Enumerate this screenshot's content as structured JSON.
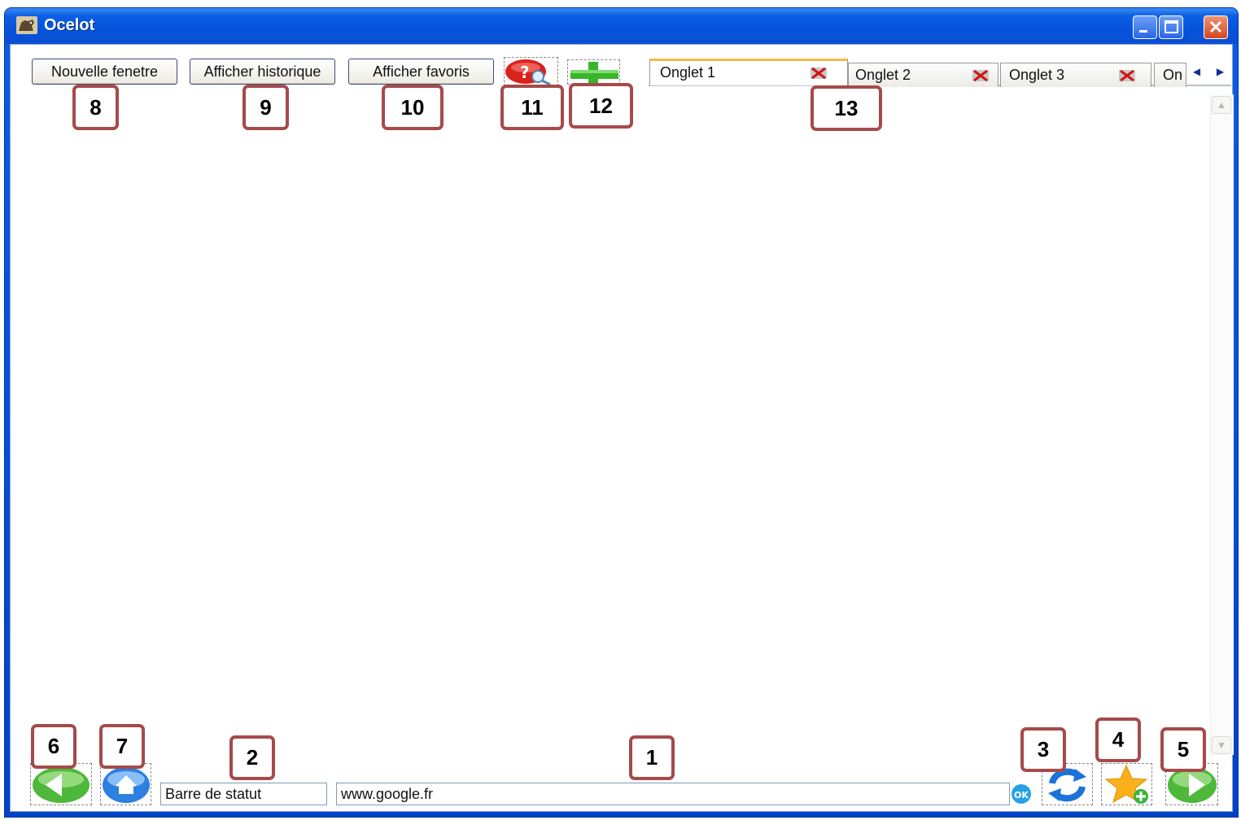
{
  "window": {
    "title": "Ocelot"
  },
  "toolbar": {
    "new_window_label": "Nouvelle fenetre",
    "history_label": "Afficher historique",
    "favorites_label": "Afficher favoris",
    "help_icon": "help-search-icon",
    "new_tab_icon": "plus-icon"
  },
  "tabs": [
    {
      "label": "Onglet 1",
      "active": true
    },
    {
      "label": "Onglet 2",
      "active": false
    },
    {
      "label": "Onglet 3",
      "active": false
    },
    {
      "label": "On",
      "active": false
    }
  ],
  "bottom_bar": {
    "status_text": "Barre de statut",
    "url_value": "www.google.fr",
    "go_icon": "ok-icon",
    "back_icon": "back-arrow-icon",
    "home_icon": "home-icon",
    "refresh_icon": "refresh-icon",
    "add_favorite_icon": "star-add-icon",
    "forward_icon": "forward-arrow-icon"
  },
  "callouts": {
    "c1": "1",
    "c2": "2",
    "c3": "3",
    "c4": "4",
    "c5": "5",
    "c6": "6",
    "c7": "7",
    "c8": "8",
    "c9": "9",
    "c10": "10",
    "c11": "11",
    "c12": "12",
    "c13": "13"
  },
  "colors": {
    "titlebar": "#0a5ee3",
    "callout_border": "#a64a4a",
    "active_tab_accent": "#f5b94a"
  }
}
